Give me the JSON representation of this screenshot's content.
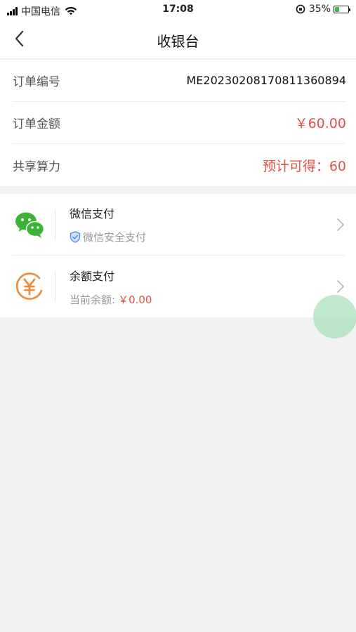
{
  "status_bar": {
    "carrier": "中国电信",
    "time": "17:08",
    "battery": "35%",
    "battery_level": 0.35
  },
  "nav": {
    "title": "收银台",
    "back_icon": "chevron-left-icon"
  },
  "order": {
    "rows": [
      {
        "label": "订单编号",
        "value": "ME20230208170811360894"
      },
      {
        "label": "订单金额",
        "value": "￥60.00"
      },
      {
        "label": "共享算力",
        "value": "预计可得：60"
      }
    ]
  },
  "payment": {
    "methods": [
      {
        "title": "微信支付",
        "subtitle": "微信安全支付",
        "icon": "wechat-icon"
      },
      {
        "title": "余额支付",
        "subtitle": "当前余额:",
        "amount": "￥0.00",
        "icon": "yuan-coin-icon"
      }
    ]
  },
  "colors": {
    "accent_red": "#e0504a",
    "wechat_green": "#3db236",
    "balance_orange": "#f08a3c"
  }
}
